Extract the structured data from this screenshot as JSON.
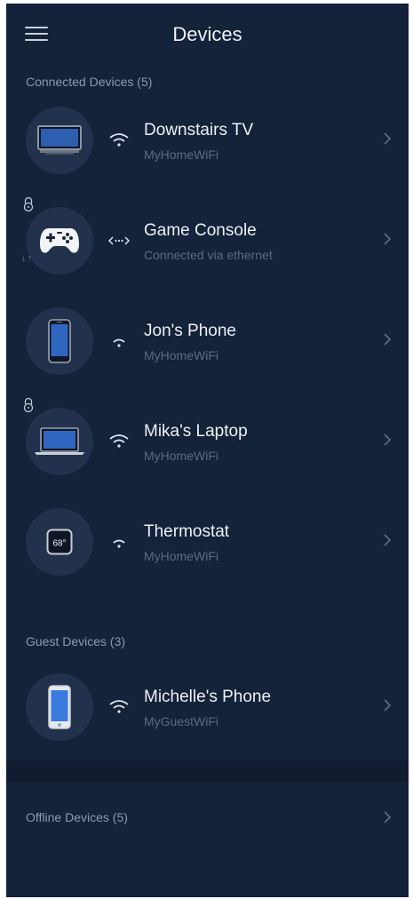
{
  "header": {
    "title": "Devices"
  },
  "sections": {
    "connected": "Connected Devices (5)",
    "guest": "Guest Devices (3)",
    "offline": "Offline Devices (5)"
  },
  "devices": [
    {
      "name": "Downstairs TV",
      "sub": "MyHomeWiFi",
      "icon": "tv-icon",
      "connection": "wifi"
    },
    {
      "name": "Game Console",
      "sub": "Connected via ethernet",
      "icon": "game-controller-icon",
      "connection": "ethernet"
    },
    {
      "name": "Jon's Phone",
      "sub": "MyHomeWiFi",
      "icon": "phone-icon",
      "connection": "wifi"
    },
    {
      "name": "Mika's Laptop",
      "sub": "MyHomeWiFi",
      "icon": "laptop-icon",
      "connection": "wifi"
    },
    {
      "name": "Thermostat",
      "sub": "MyHomeWiFi",
      "icon": "thermostat-icon",
      "connection": "wifi",
      "reading": "68°"
    }
  ],
  "guest_devices": [
    {
      "name": "Michelle's Phone",
      "sub": "MyGuestWiFi",
      "icon": "phone-icon",
      "connection": "wifi"
    }
  ],
  "colors": {
    "background": "#14223a",
    "circle": "#22324d",
    "text_primary": "#eef1f6",
    "text_secondary": "#5d6a80"
  }
}
